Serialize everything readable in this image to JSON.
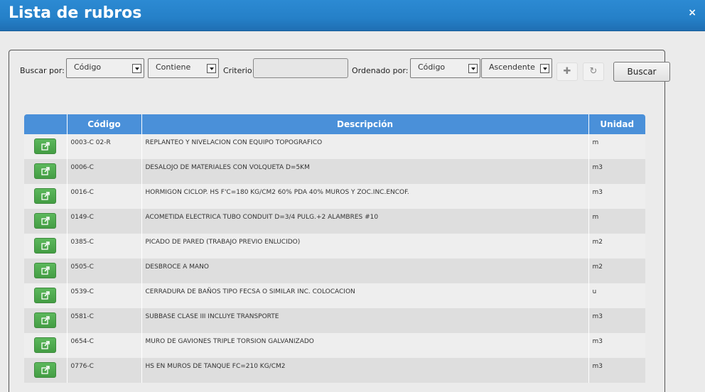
{
  "window": {
    "title": "Lista de rubros",
    "close": "×"
  },
  "search": {
    "buscar_por_label": "Buscar por:",
    "field_value": "Código",
    "condition_value": "Contiene",
    "criterio_label": "Criterio:",
    "criterio_value": "",
    "ordenado_por_label": "Ordenado por:",
    "order_field_value": "Código",
    "order_dir_value": "Ascendente",
    "add_icon": "plus-icon",
    "reset_icon": "reset-icon",
    "buscar_label": "Buscar"
  },
  "table": {
    "headers": [
      "",
      "Código",
      "Descripción",
      "Unidad"
    ],
    "rows": [
      {
        "codigo": "0003-C 02-R",
        "descripcion": "REPLANTEO Y NIVELACION CON EQUIPO TOPOGRAFICO",
        "unidad": "m"
      },
      {
        "codigo": "0006-C",
        "descripcion": "DESALOJO DE MATERIALES CON VOLQUETA D=5KM",
        "unidad": "m3"
      },
      {
        "codigo": "0016-C",
        "descripcion": "HORMIGON CICLOP. HS F'C=180 KG/CM2 60% PDA 40% MUROS Y ZOC.INC.ENCOF.",
        "unidad": "m3"
      },
      {
        "codigo": "0149-C",
        "descripcion": "ACOMETIDA ELECTRICA TUBO CONDUIT D=3/4 PULG.+2 ALAMBRES #10",
        "unidad": "m"
      },
      {
        "codigo": "0385-C",
        "descripcion": "PICADO DE PARED (TRABAJO PREVIO ENLUCIDO)",
        "unidad": "m2"
      },
      {
        "codigo": "0505-C",
        "descripcion": "DESBROCE A MANO",
        "unidad": "m2"
      },
      {
        "codigo": "0539-C",
        "descripcion": "CERRADURA DE BAÑOS TIPO FECSA O SIMILAR INC. COLOCACION",
        "unidad": "u"
      },
      {
        "codigo": "0581-C",
        "descripcion": "SUBBASE CLASE III INCLUYE TRANSPORTE",
        "unidad": "m3"
      },
      {
        "codigo": "0654-C",
        "descripcion": "MURO DE GAVIONES TRIPLE TORSION GALVANIZADO",
        "unidad": "m3"
      },
      {
        "codigo": "0776-C",
        "descripcion": "HS EN MUROS DE TANQUE FC=210 KG/CM2",
        "unidad": "m3"
      }
    ],
    "row_action_icon": "share-icon"
  },
  "colors": {
    "titlebar": "#2580c8",
    "header": "#4a90d9",
    "row_button": "#5cb85c"
  }
}
